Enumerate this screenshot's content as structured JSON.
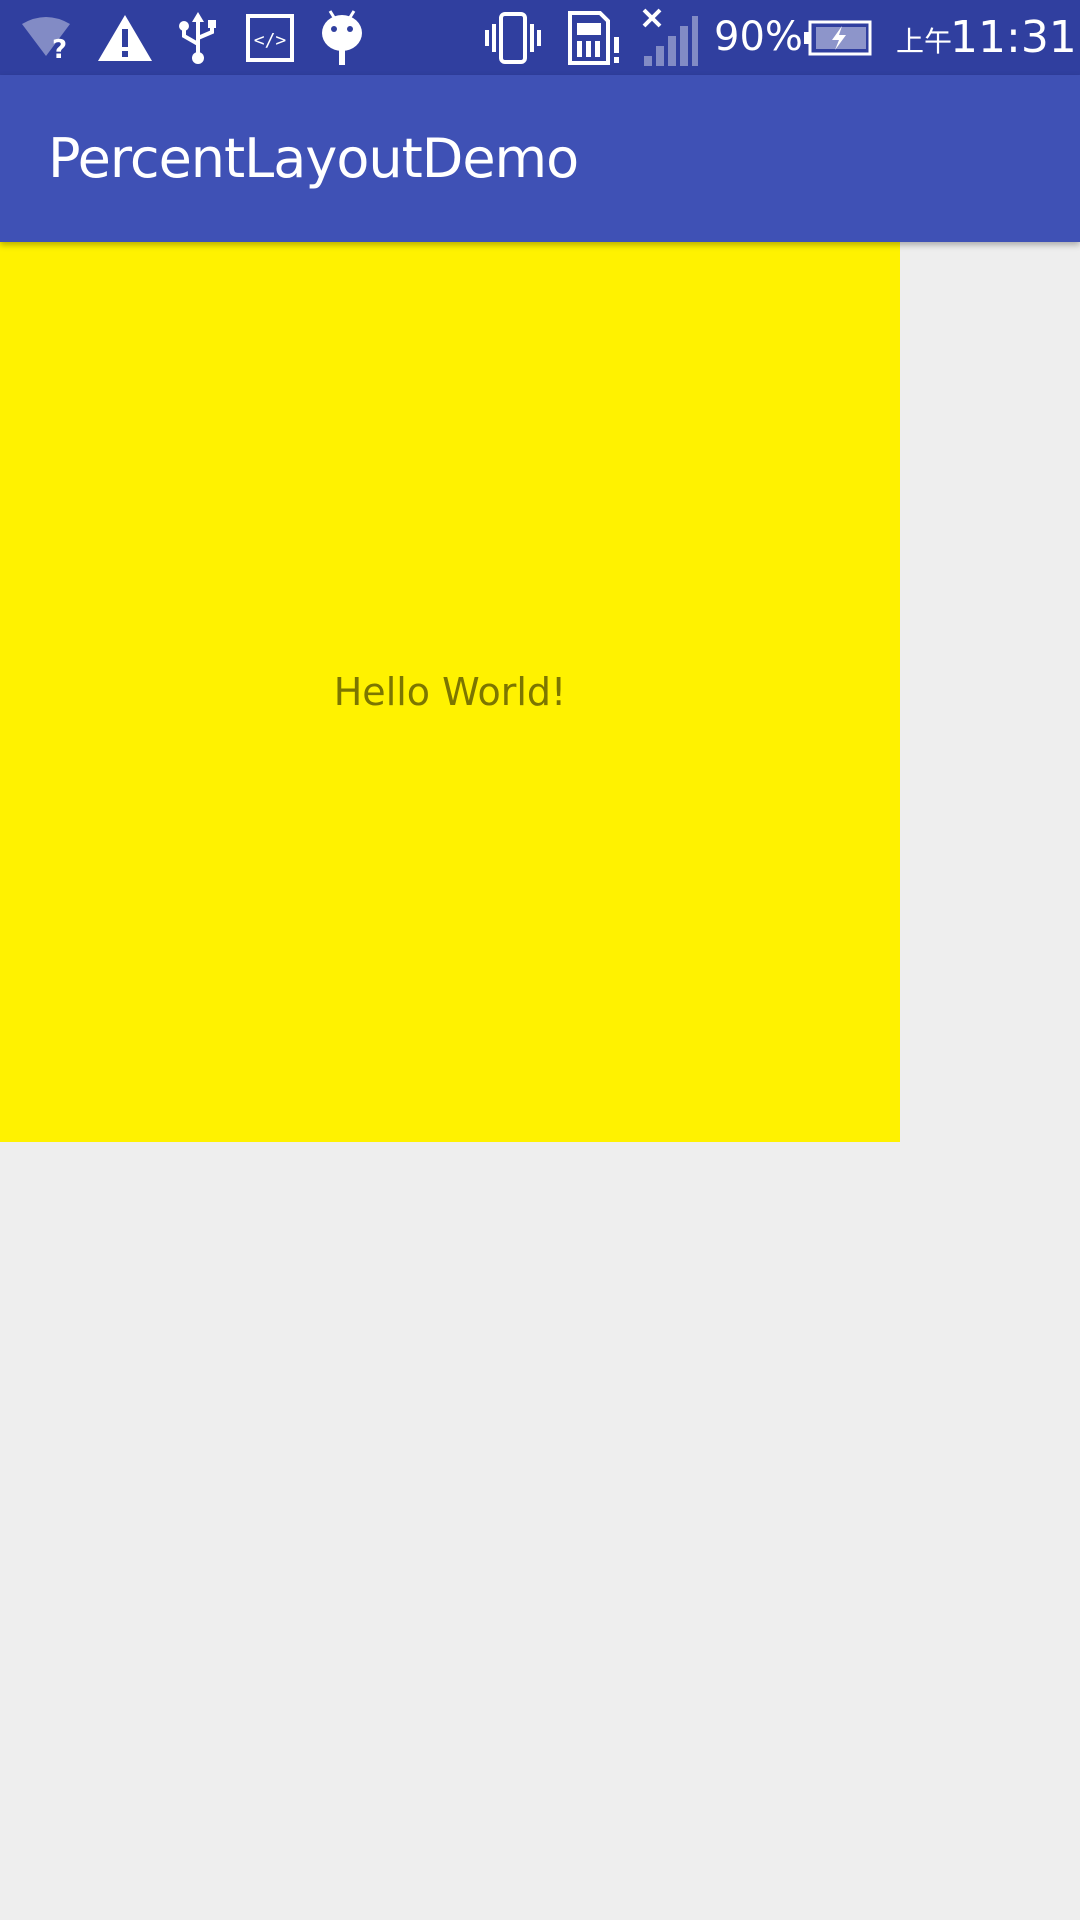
{
  "status_bar": {
    "icons": {
      "wifi": "wifi-unknown-icon",
      "warning": "warning-icon",
      "usb": "usb-icon",
      "developer": "developer-code-icon",
      "android": "android-debug-icon",
      "vibrate": "vibrate-icon",
      "sim": "sim-alert-icon",
      "signal": "signal-off-icon",
      "battery": "battery-charging-icon"
    },
    "battery_percent": "90%",
    "ampm": "上午",
    "time": "11:31"
  },
  "app_bar": {
    "title": "PercentLayoutDemo"
  },
  "content": {
    "box_text": "Hello World!"
  },
  "colors": {
    "status_bar": "#303F9F",
    "app_bar": "#3F51B5",
    "box": "#FFF200",
    "background": "#EEEEEE",
    "text": "#757000"
  }
}
